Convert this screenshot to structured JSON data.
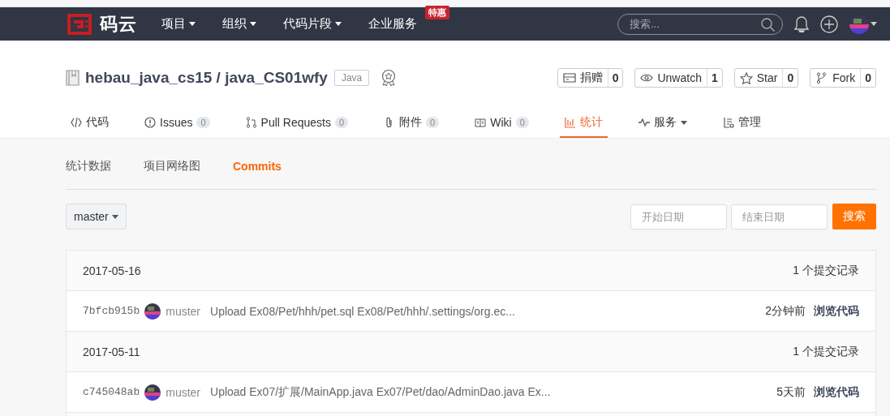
{
  "topbar": {
    "logo": "码云",
    "nav": [
      {
        "label": "项目",
        "dropdown": true
      },
      {
        "label": "组织",
        "dropdown": true
      },
      {
        "label": "代码片段",
        "dropdown": true
      },
      {
        "label": "企业服务",
        "dropdown": false,
        "badge": "特惠"
      }
    ],
    "search": {
      "placeholder": "搜索..."
    }
  },
  "repo": {
    "owner": "hebau_java_cs15",
    "separator": "/",
    "name": "java_CS01wfy",
    "language": "Java",
    "actions": [
      {
        "kind": "donate",
        "label": "捐赠",
        "count": "0"
      },
      {
        "kind": "watch",
        "label": "Unwatch",
        "count": "1"
      },
      {
        "kind": "star",
        "label": "Star",
        "count": "0"
      },
      {
        "kind": "fork",
        "label": "Fork",
        "count": "0"
      }
    ],
    "tabs": [
      {
        "kind": "code",
        "label": "代码",
        "selected": false
      },
      {
        "kind": "issues",
        "label": "Issues",
        "count": "0",
        "selected": false
      },
      {
        "kind": "pulls",
        "label": "Pull Requests",
        "count": "0",
        "selected": false
      },
      {
        "kind": "attach",
        "label": "附件",
        "count": "0",
        "selected": false
      },
      {
        "kind": "wiki",
        "label": "Wiki",
        "count": "0",
        "selected": false
      },
      {
        "kind": "stats",
        "label": "统计",
        "selected": true
      },
      {
        "kind": "service",
        "label": "服务",
        "dropdown": true,
        "selected": false
      },
      {
        "kind": "manage",
        "label": "管理",
        "selected": false
      }
    ]
  },
  "subtabs": [
    {
      "label": "统计数据",
      "selected": false
    },
    {
      "label": "项目网络图",
      "selected": false
    },
    {
      "label": "Commits",
      "selected": true
    }
  ],
  "branch": "master",
  "date_filter": {
    "start_placeholder": "开始日期",
    "end_placeholder": "结束日期",
    "button": "搜索"
  },
  "groups": [
    {
      "date": "2017-05-16",
      "count_text": "1 个提交记录",
      "commits": [
        {
          "sha": "7bfcb915b",
          "author": "muster",
          "message": "Upload Ex08/Pet/hhh/pet.sql Ex08/Pet/hhh/.settings/org.ec...",
          "time": "2分钟前",
          "link": "浏览代码"
        }
      ]
    },
    {
      "date": "2017-05-11",
      "count_text": "1 个提交记录",
      "commits": [
        {
          "sha": "c745048ab",
          "author": "muster",
          "message": "Upload Ex07/扩展/MainApp.java Ex07/Pet/dao/AdminDao.java Ex...",
          "time": "5天前",
          "link": "浏览代码"
        }
      ]
    }
  ]
}
